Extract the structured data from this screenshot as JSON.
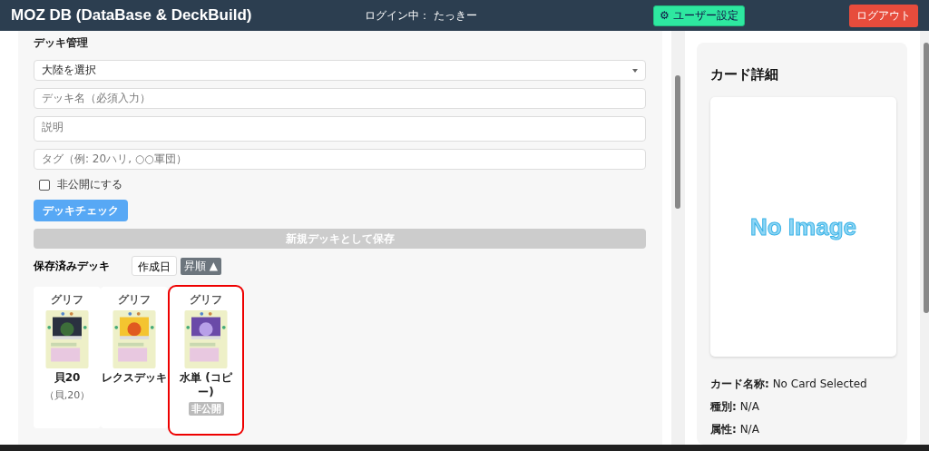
{
  "header": {
    "title": "MOZ DB (DataBase & DeckBuild)",
    "login": "ログイン中： たっきー",
    "settings_button": "⚙ ユーザー設定",
    "logout_button": "ログアウト"
  },
  "deck_panel": {
    "title": "デッキ管理",
    "continent_select": "大陸を選択",
    "name_placeholder": "デッキ名（必須入力）",
    "description_placeholder": "説明",
    "tag_placeholder": "タグ（例: 20ハリ, ○○軍団）",
    "private_checkbox": {
      "label": "非公開にする",
      "checked": false
    },
    "check_button": "デッキチェック",
    "save_button": {
      "label": "新規デッキとして保存",
      "disabled": true
    },
    "saved_label": "保存済みデッキ",
    "sort_field": "作成日",
    "order_button": "昇順 ▲",
    "decks": [
      {
        "category": "グリフ",
        "name": "貝20",
        "tags": "（貝,20）",
        "selected": false
      },
      {
        "category": "グリフ",
        "name": "レクスデッキ",
        "selected": false
      },
      {
        "category": "グリフ",
        "name": "水単 (コピー)",
        "private_label": "非公開",
        "selected": true
      }
    ]
  },
  "card_detail": {
    "title": "カード詳細",
    "image_text": "No Image",
    "fields": [
      {
        "label": "カード名称:",
        "value": "No Card Selected"
      },
      {
        "label": "種別:",
        "value": "N/A"
      },
      {
        "label": "属性:",
        "value": "N/A"
      }
    ]
  }
}
